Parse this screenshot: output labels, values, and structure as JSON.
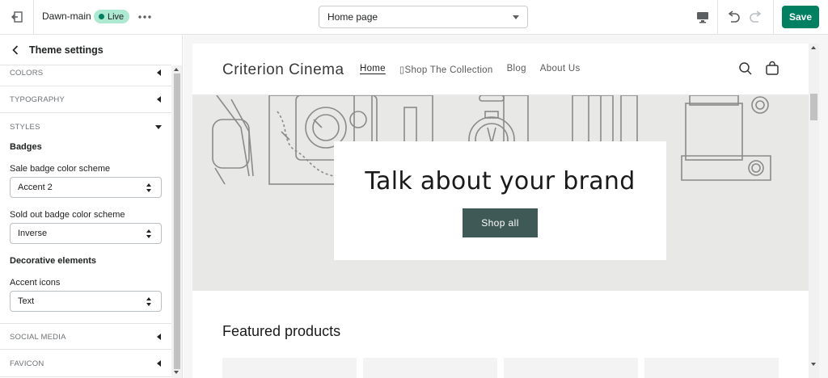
{
  "topbar": {
    "theme_name": "Dawn-main",
    "live_label": "Live",
    "page_select_value": "Home page",
    "save_label": "Save",
    "icons": [
      "exit-icon",
      "more-icon",
      "desktop-icon",
      "undo-icon",
      "redo-icon"
    ]
  },
  "sidebar": {
    "title": "Theme settings",
    "sections": {
      "colors": "COLORS",
      "typography": "TYPOGRAPHY",
      "styles": "STYLES",
      "social_media": "SOCIAL MEDIA",
      "favicon": "FAVICON"
    },
    "badges_heading": "Badges",
    "sale_badge_label": "Sale badge color scheme",
    "sale_badge_value": "Accent 2",
    "soldout_badge_label": "Sold out badge color scheme",
    "soldout_badge_value": "Inverse",
    "decorative_heading": "Decorative elements",
    "accent_icons_label": "Accent icons",
    "accent_icons_value": "Text"
  },
  "preview": {
    "store_name": "Criterion Cinema",
    "nav": [
      "Home",
      "▯Shop The Collection",
      "Blog",
      "About Us"
    ],
    "hero_heading": "Talk about your brand",
    "hero_button": "Shop all",
    "featured_title": "Featured products"
  },
  "colors": {
    "accent": "#008060",
    "live_badge_bg": "#aee9d1",
    "hero_button_bg": "#3f5957",
    "hero_bg": "#e8e8e7"
  }
}
